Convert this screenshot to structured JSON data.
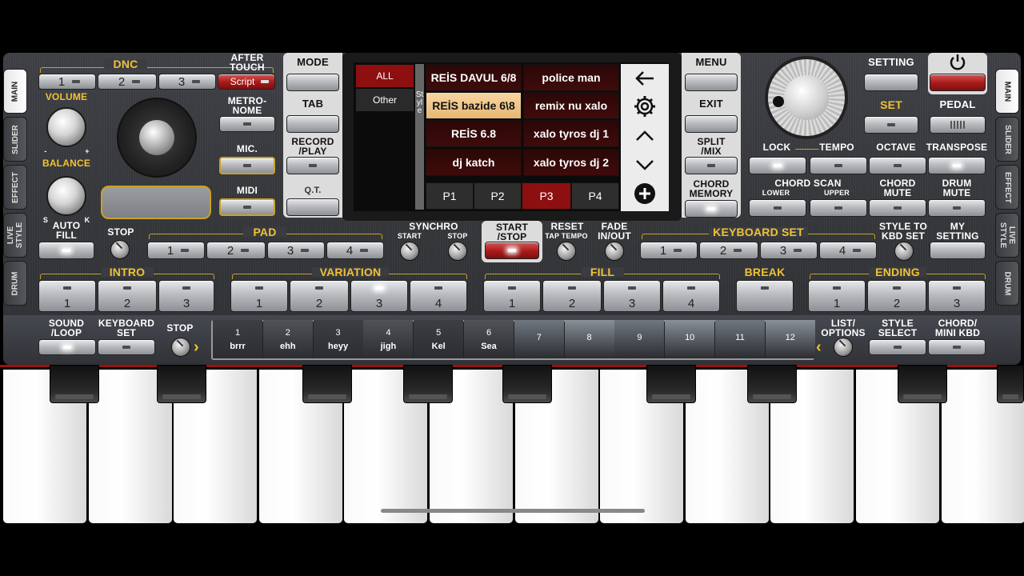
{
  "side_tabs_left": [
    "MAIN",
    "SLIDER",
    "EFFECT",
    "LIVE\nSTYLE",
    "DRUM"
  ],
  "side_tabs_right": [
    "MAIN",
    "SLIDER",
    "EFFECT",
    "LIVE\nSTYLE",
    "DRUM"
  ],
  "dnc": {
    "label": "DNC",
    "buttons": [
      "1",
      "2",
      "3"
    ],
    "script": "Script"
  },
  "after_touch": "AFTER\nTOUCH",
  "metronome": "METRO-\nNOME",
  "mic": "MIC.",
  "midi": "MIDI",
  "volume": "VOLUME",
  "balance": "BALANCE",
  "balance_marks": [
    "-",
    "+",
    "S",
    "K"
  ],
  "auto_fill": "AUTO\nFILL",
  "left_menu": [
    "MODE",
    "TAB",
    "RECORD\n/PLAY",
    "Q.T."
  ],
  "right_menu": [
    "MENU",
    "EXIT",
    "SPLIT\n/MIX",
    "CHORD\nMEMORY"
  ],
  "screen": {
    "categories": [
      "ALL",
      "Other"
    ],
    "side_label": "Style",
    "side_extra": "2/4 3/4",
    "styles": [
      [
        "REİS DAVUL 6/8",
        "police man"
      ],
      [
        "REİS bazide 6\\8",
        "remix nu xalo"
      ],
      [
        "REİS 6.8",
        "xalo tyros dj 1"
      ],
      [
        "dj katch",
        "xalo tyros dj 2"
      ]
    ],
    "selected_style": "REİS bazide 6\\8",
    "pages": [
      "P1",
      "P2",
      "P3",
      "P4"
    ],
    "selected_page": "P3",
    "nav_icons": [
      "back-arrow-icon",
      "gear-icon",
      "chevron-up-icon",
      "chevron-down-icon",
      "add-icon"
    ]
  },
  "setting": "SETTING",
  "set": "SET",
  "pedal": "PEDAL",
  "lock": "LOCK",
  "tempo": "TEMPO",
  "octave": "OCTAVE",
  "transpose": "TRANSPOSE",
  "chord_scan": "CHORD SCAN",
  "chord_scan_sub": [
    "LOWER",
    "UPPER"
  ],
  "chord_mute": "CHORD\nMUTE",
  "drum_mute": "DRUM\nMUTE",
  "stop": "STOP",
  "pad": {
    "label": "PAD",
    "buttons": [
      "1",
      "2",
      "3",
      "4"
    ]
  },
  "synchro": {
    "label": "SYNCHRO",
    "start": "START",
    "stop": "STOP"
  },
  "start_stop": "START\n/STOP",
  "reset": "RESET",
  "tap_tempo": "TAP TEMPO",
  "fade": "FADE\nIN/OUT",
  "keyboard_set": {
    "label": "KEYBOARD SET",
    "buttons": [
      "1",
      "2",
      "3",
      "4"
    ]
  },
  "style_to_kbd": "STYLE TO\nKBD SET",
  "my_setting": "MY\nSETTING",
  "intro": {
    "label": "INTRO",
    "buttons": [
      "1",
      "2",
      "3"
    ]
  },
  "variation": {
    "label": "VARIATION",
    "buttons": [
      "1",
      "2",
      "3",
      "4"
    ],
    "active": "3"
  },
  "fill": {
    "label": "FILL",
    "buttons": [
      "1",
      "2",
      "3",
      "4"
    ]
  },
  "break": "BREAK",
  "ending": {
    "label": "ENDING",
    "buttons": [
      "1",
      "2",
      "3"
    ]
  },
  "sound_loop": "SOUND\n/LOOP",
  "keyboard_set2": "KEYBOARD\nSET",
  "stop2": "STOP",
  "list_options": "LIST/\nOPTIONS",
  "style_select": "STYLE\nSELECT",
  "chord_mini": "CHORD/\nMINI KBD",
  "slots": [
    {
      "n": "1",
      "t": "brrr"
    },
    {
      "n": "2",
      "t": "ehh"
    },
    {
      "n": "3",
      "t": "heyy"
    },
    {
      "n": "4",
      "t": "jigh"
    },
    {
      "n": "5",
      "t": "Kel"
    },
    {
      "n": "6",
      "t": "Sea"
    },
    {
      "n": "7",
      "t": ""
    },
    {
      "n": "8",
      "t": ""
    },
    {
      "n": "9",
      "t": ""
    },
    {
      "n": "10",
      "t": ""
    },
    {
      "n": "11",
      "t": ""
    },
    {
      "n": "12",
      "t": ""
    }
  ],
  "colors": {
    "accent": "#f1c232",
    "red": "#a81a1a",
    "selected_style": "#e7b775"
  }
}
